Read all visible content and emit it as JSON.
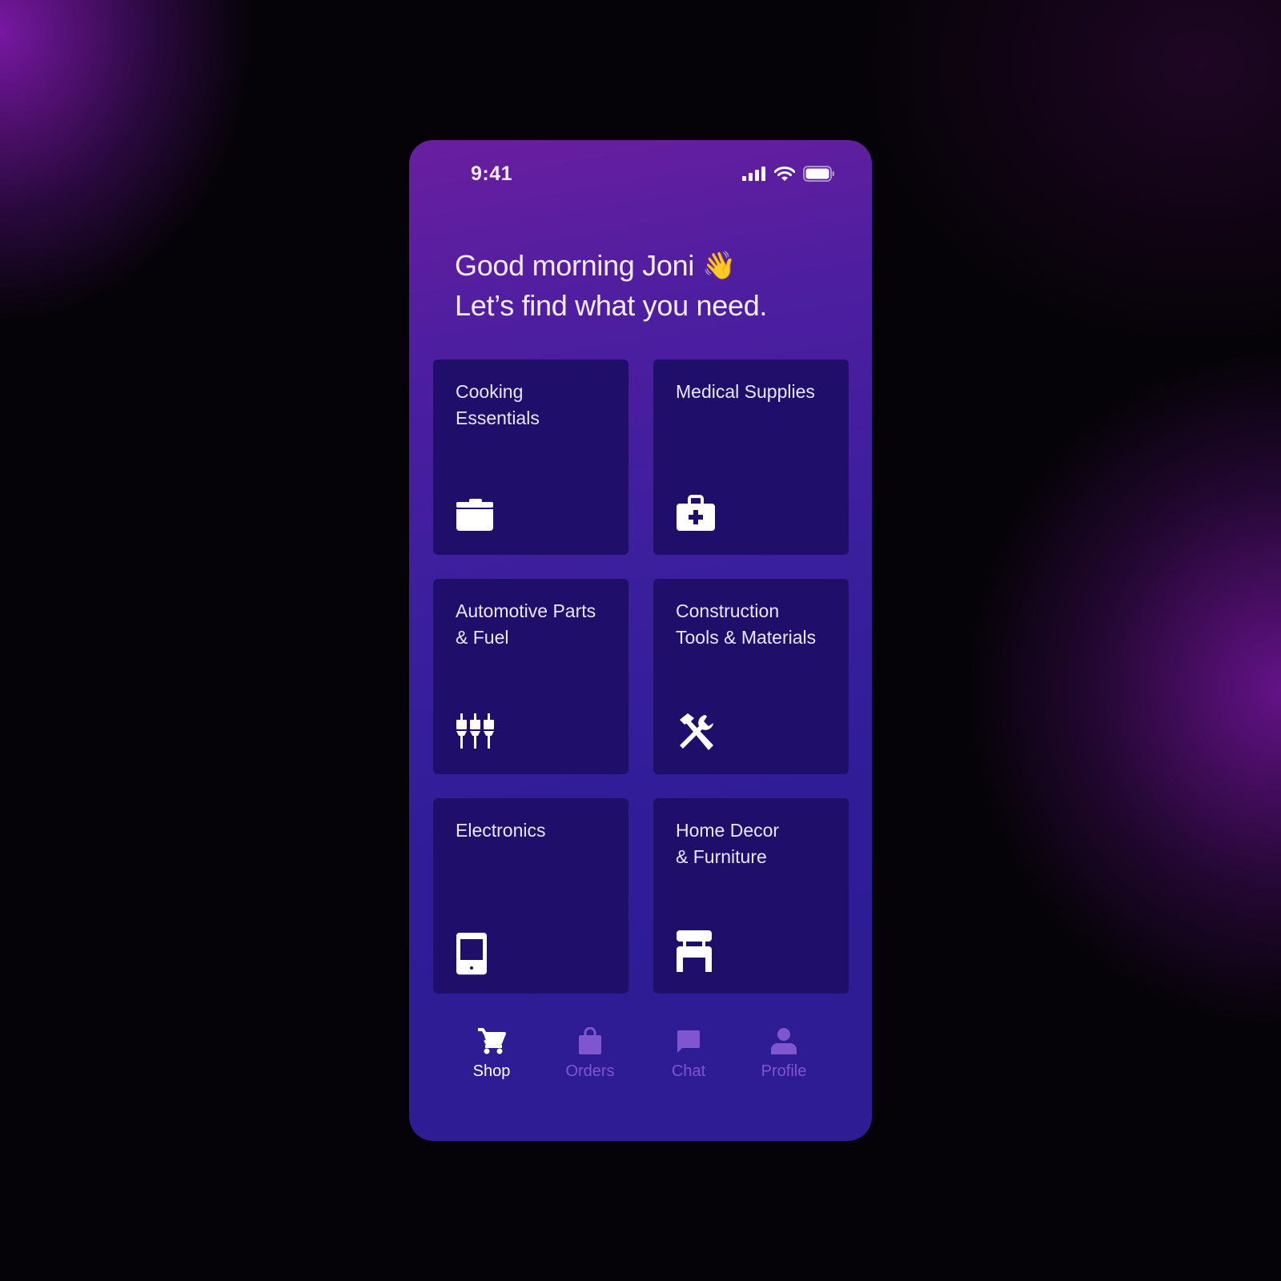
{
  "status_bar": {
    "time": "9:41",
    "icons": [
      "signal-icon",
      "wifi-icon",
      "battery-icon"
    ]
  },
  "greeting": {
    "line1": "Good morning Joni",
    "emoji": "👋",
    "line2": "Let’s find what you need."
  },
  "categories": [
    {
      "label": "Cooking\nEssentials",
      "icon": "cooking-pot-icon"
    },
    {
      "label": "Medical Supplies",
      "icon": "medical-kit-icon"
    },
    {
      "label": "Automotive Parts\n& Fuel",
      "icon": "spark-plugs-icon"
    },
    {
      "label": "Construction\nTools & Materials",
      "icon": "hammer-wrench-icon"
    },
    {
      "label": "Electronics",
      "icon": "mobile-phone-icon"
    },
    {
      "label": "Home Decor\n& Furniture",
      "icon": "chair-icon"
    }
  ],
  "bottom_nav": {
    "items": [
      {
        "label": "Shop",
        "icon": "cart-icon",
        "active": true
      },
      {
        "label": "Orders",
        "icon": "shopping-bag-icon",
        "active": false
      },
      {
        "label": "Chat",
        "icon": "chat-bubble-icon",
        "active": false
      },
      {
        "label": "Profile",
        "icon": "user-icon",
        "active": false
      }
    ]
  },
  "colors": {
    "card_bg": "#1f0f6b",
    "nav_active": "#ffffff",
    "nav_inactive": "#7f56cf",
    "text": "#f3ecff"
  }
}
